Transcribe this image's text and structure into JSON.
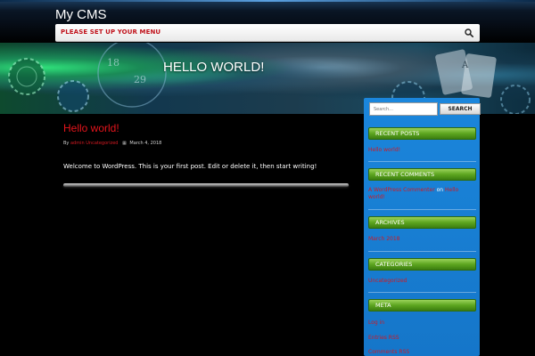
{
  "site": {
    "title": "My CMS",
    "menu_notice": "PLEASE SET UP YOUR MENU"
  },
  "banner": {
    "title": "HELLO WORLD!"
  },
  "post": {
    "title": "Hello world!",
    "meta_by": "By",
    "author": "admin",
    "category": "Uncategorized",
    "date": "March 4, 2018",
    "body": "Welcome to WordPress. This is your first post. Edit or delete it, then start writing!"
  },
  "sidebar": {
    "search": {
      "placeholder": "Search...",
      "button_label": "SEARCH"
    },
    "recent_posts": {
      "title": "RECENT POSTS",
      "items": [
        "Hello world!"
      ]
    },
    "recent_comments": {
      "title": "RECENT COMMENTS",
      "author": "A WordPress Commenter",
      "on": "on",
      "post": "Hello",
      "post_cont": "world!"
    },
    "archives": {
      "title": "ARCHIVES",
      "items": [
        "March 2018"
      ]
    },
    "categories": {
      "title": "CATEGORIES",
      "items": [
        "Uncategorized"
      ]
    },
    "meta": {
      "title": "META",
      "items": [
        "Log in",
        "Entries RSS",
        "Comments RSS"
      ]
    }
  },
  "colors": {
    "accent_red": "#e4141c",
    "sidebar_blue": "#1b86dc",
    "widget_green": "#5da51f",
    "background": "#000000"
  },
  "icons": {
    "menu_search": "search-icon",
    "post_calendar": "calendar-icon"
  }
}
